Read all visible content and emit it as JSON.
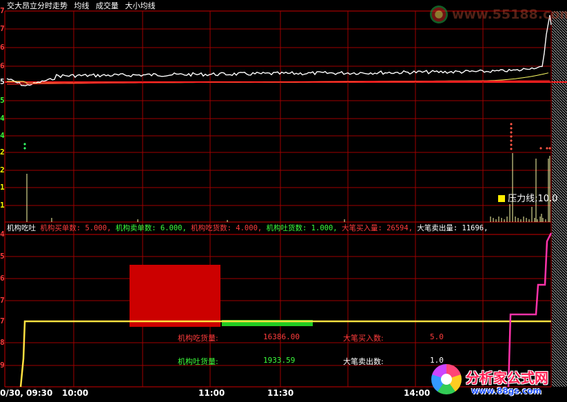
{
  "top_panel": {
    "title": "交大昂立分时走势",
    "legend": [
      "均线",
      "成交量",
      "大小均线"
    ]
  },
  "mid_panel": {
    "pressure_label": "压力线;10.0"
  },
  "bottom_panel": {
    "title": "机构吃吐",
    "stats": [
      {
        "text": "机构买单数: 5.000,",
        "color": "#ff3c3c"
      },
      {
        "text": "机构卖单数: 6.000,",
        "color": "#3cff3c"
      },
      {
        "text": "机构吃货数: 4.000,",
        "color": "#ff3c3c"
      },
      {
        "text": "机构吐货数: 1.000,",
        "color": "#3cff3c"
      },
      {
        "text": "大笔买入量: 26594,",
        "color": "#ff3c3c"
      },
      {
        "text": "大笔卖出量: 11696,",
        "color": "#ffffff"
      }
    ],
    "eat_label": "机构吃货量:",
    "eat_value": "16386.00",
    "spit_label": "机构吐货量:",
    "spit_value": "1933.59",
    "big_buy_label": "大笔买入数:",
    "big_buy_value": "5.0",
    "big_sell_label": "大笔卖出数:",
    "big_sell_value": "1.0"
  },
  "y_labels_top": [
    {
      "text": "7",
      "color": "#ff3c3c"
    },
    {
      "text": "7",
      "color": "#ff3c3c"
    },
    {
      "text": "6",
      "color": "#ff3c3c"
    },
    {
      "text": "6",
      "color": "#ff3c3c"
    },
    {
      "text": "5",
      "color": "#ffffff"
    },
    {
      "text": "5",
      "color": "#3cff3c"
    }
  ],
  "y_labels_mid": [
    {
      "text": "4",
      "color": "#3cff3c"
    },
    {
      "text": "4",
      "color": "#3cff3c"
    },
    {
      "text": "2",
      "color": "#ffff00"
    },
    {
      "text": "2",
      "color": "#ffff00"
    },
    {
      "text": "1",
      "color": "#ffff00"
    },
    {
      "text": "1",
      "color": "#ffff00"
    }
  ],
  "y_labels_bottom": [
    {
      "text": "4",
      "color": "#ff3c3c"
    },
    {
      "text": "5",
      "color": "#ff3c3c"
    },
    {
      "text": "6",
      "color": "#ff3c3c"
    },
    {
      "text": "7",
      "color": "#ff3c3c"
    },
    {
      "text": "7",
      "color": "#ff3c3c"
    },
    {
      "text": "8",
      "color": "#ff3c3c"
    },
    {
      "text": "9",
      "color": "#ff3c3c"
    }
  ],
  "time_axis": [
    "0/30, 09:30",
    "10:00",
    "11:00",
    "11:30",
    "14:00"
  ],
  "watermarks": {
    "top": "www.55188.com",
    "bottom_brand": "分析家公式网",
    "bottom_url": "www.88gs.com"
  },
  "colors": {
    "grid": "#a00000",
    "price": "#ffffff",
    "avg": "#ffff66",
    "ma_red": "#ff2020",
    "yellow_line": "#ffe040",
    "pink_line": "#ff33aa",
    "eat_box": "#cc0000",
    "spit_bar": "#22cc22"
  }
}
